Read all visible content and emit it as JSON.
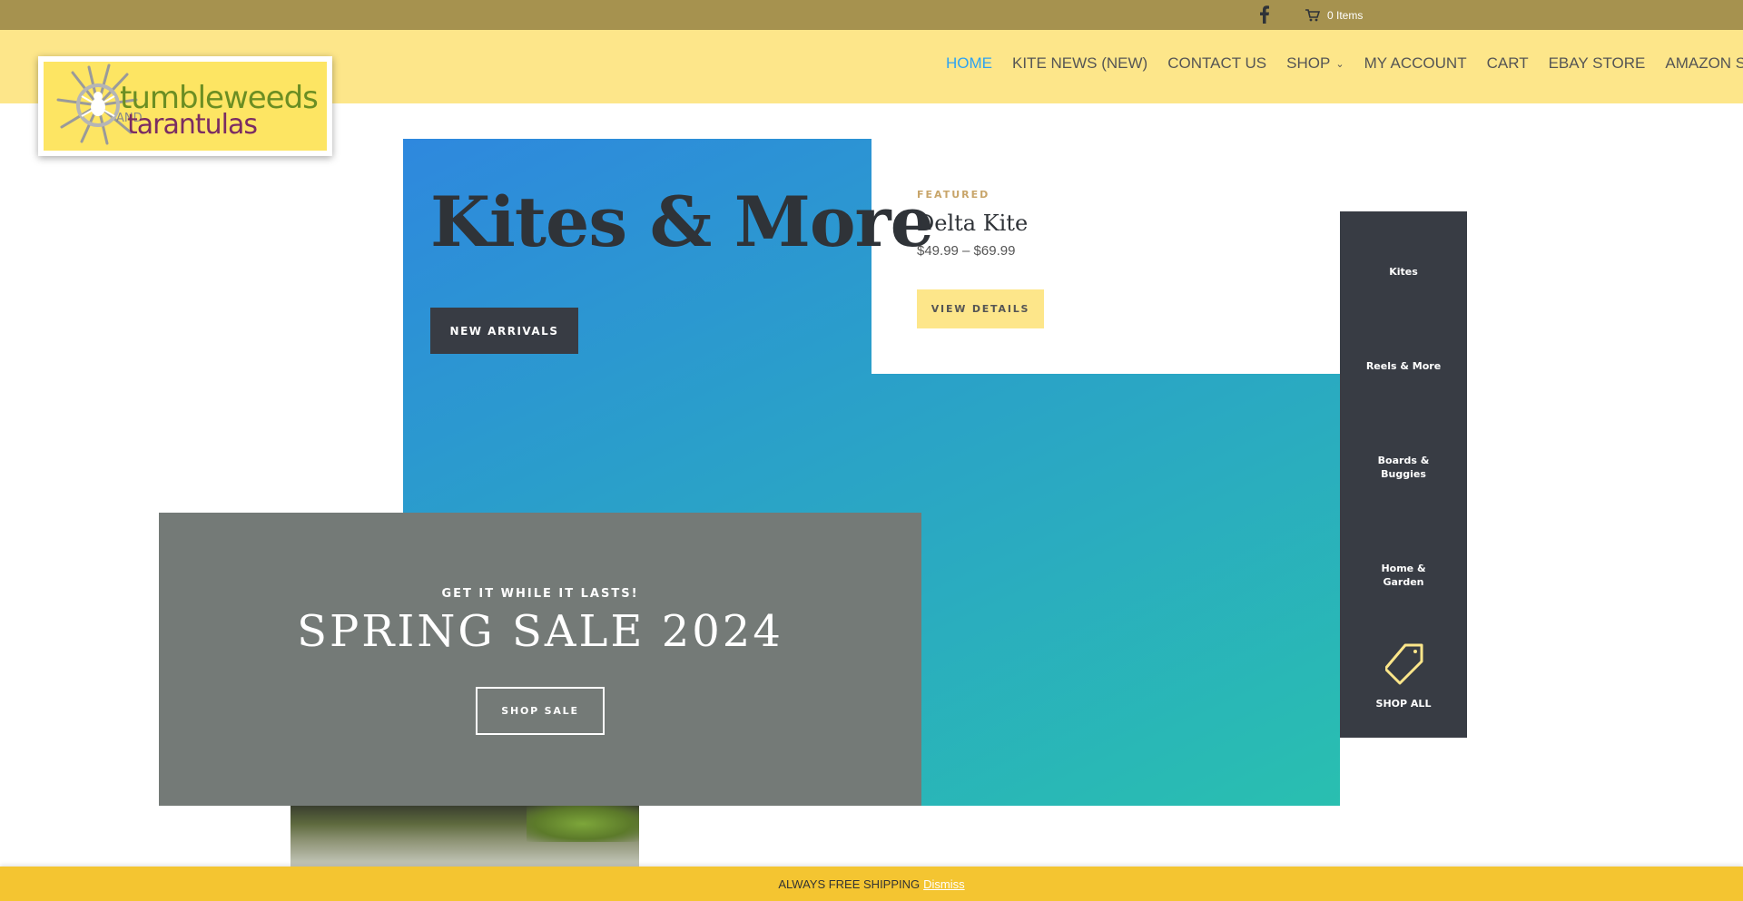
{
  "topbar": {
    "facebook_icon": "facebook-icon",
    "cart_label": "0 Items",
    "cart_icon": "cart-icon"
  },
  "logo": {
    "line1": "tumbleweeds",
    "and": "AND",
    "line2": "tarantulas"
  },
  "nav": {
    "items": [
      {
        "label": "HOME",
        "active": true
      },
      {
        "label": "KITE NEWS (NEW)"
      },
      {
        "label": "CONTACT US"
      },
      {
        "label": "SHOP",
        "has_dropdown": true
      },
      {
        "label": "MY ACCOUNT"
      },
      {
        "label": "CART"
      },
      {
        "label": "EBAY STORE"
      },
      {
        "label": "AMAZON STORE"
      }
    ]
  },
  "hero": {
    "title": "Kites & More",
    "button": "NEW ARRIVALS"
  },
  "featured": {
    "label": "FEATURED",
    "title": "Delta Kite",
    "price": "$49.99 – $69.99",
    "button": "VIEW DETAILS"
  },
  "categories": {
    "items": [
      "Kites",
      "Reels & More",
      "Boards &\nBuggies",
      "Home &\nGarden"
    ],
    "shop_all": "SHOP ALL",
    "shop_all_icon": "tag-icon"
  },
  "sale": {
    "subtitle": "GET IT WHILE IT LASTS!",
    "title": "SPRING SALE 2024",
    "button": "SHOP SALE"
  },
  "notice": {
    "text": "ALWAYS FREE SHIPPING",
    "dismiss": "Dismiss"
  },
  "colors": {
    "topbar": "#a6924f",
    "header": "#fde68a",
    "nav_active": "#2ea3f2",
    "dark": "#383c44",
    "notice": "#f4c531"
  }
}
